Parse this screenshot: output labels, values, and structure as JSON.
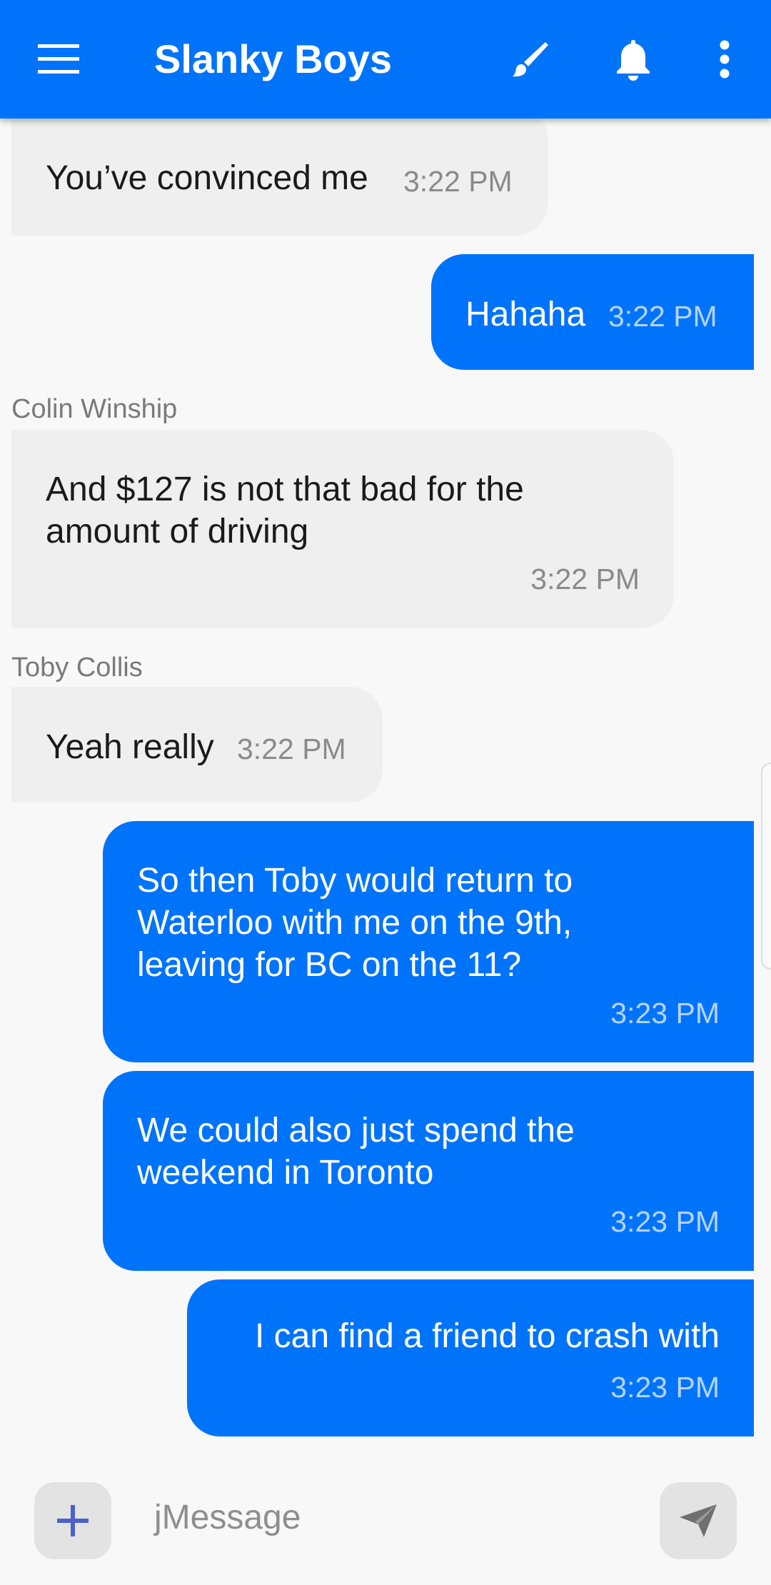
{
  "header": {
    "title": "Slanky Boys",
    "background_color": "#0073fb",
    "icons": [
      "menu-icon",
      "brush-icon",
      "bell-icon",
      "more-vertical-icon"
    ]
  },
  "messages": [
    {
      "direction": "incoming",
      "sender": "",
      "text": "You’ve convinced me",
      "time": "3:22 PM"
    },
    {
      "direction": "outgoing",
      "text": "Hahaha",
      "time": "3:22 PM"
    },
    {
      "direction": "incoming",
      "sender": "Colin Winship",
      "text": "And $127 is not that bad for the amount of driving",
      "time": "3:22 PM"
    },
    {
      "direction": "incoming",
      "sender": "Toby Collis",
      "text": "Yeah really",
      "time": "3:22 PM"
    },
    {
      "direction": "outgoing",
      "text": "So then Toby would return to Waterloo with me on the 9th, leaving for BC on the 11?",
      "time": "3:23 PM"
    },
    {
      "direction": "outgoing",
      "text": "We could also just spend the weekend in Toronto",
      "time": "3:23 PM"
    },
    {
      "direction": "outgoing",
      "text": "I can find a friend to crash with",
      "time": "3:23 PM"
    }
  ],
  "composer": {
    "placeholder": "jMessage",
    "add_icon": "plus-icon",
    "send_icon": "send-icon"
  },
  "colors": {
    "outgoing_bubble": "#0073fb",
    "incoming_bubble": "#efefef",
    "add_icon": "#4d60c9"
  }
}
